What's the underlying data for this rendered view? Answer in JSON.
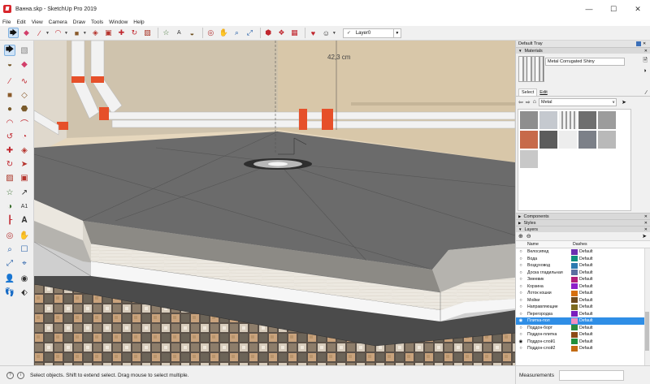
{
  "window": {
    "title": "Ванна.skp - SketchUp Pro 2019",
    "minimize": "—",
    "maximize": "☐",
    "close": "✕"
  },
  "menu": [
    "File",
    "Edit",
    "View",
    "Camera",
    "Draw",
    "Tools",
    "Window",
    "Help"
  ],
  "toolbar": {
    "layer_select_value": "Layer0",
    "layer_check": "✓"
  },
  "viewport": {
    "dimension_label": "42,3 cm"
  },
  "tray": {
    "title": "Default Tray",
    "materials_header": "Materials",
    "material_name": "Metal Corrugated Shiny",
    "tab_select": "Select",
    "tab_edit": "Edit",
    "library_value": "Metal",
    "components_header": "Components",
    "styles_header": "Styles",
    "layers_header": "Layers",
    "col_name": "Name",
    "col_dashes": "Dashes"
  },
  "layers": [
    {
      "name": "Велосипед",
      "color": "#6b2fb0",
      "dashes": "Default",
      "visible": "○",
      "selected": false
    },
    {
      "name": "Вода",
      "color": "#0f8f7e",
      "dashes": "Default",
      "visible": "○",
      "selected": false
    },
    {
      "name": "Воздуховод",
      "color": "#2c7ab0",
      "dashes": "Default",
      "visible": "○",
      "selected": false
    },
    {
      "name": "Доска гладильная",
      "color": "#5b6fa0",
      "dashes": "Default",
      "visible": "○",
      "selected": false
    },
    {
      "name": "Змеевик",
      "color": "#b21e7a",
      "dashes": "Default",
      "visible": "○",
      "selected": false
    },
    {
      "name": "Корзина",
      "color": "#8f1fc9",
      "dashes": "Default",
      "visible": "○",
      "selected": false
    },
    {
      "name": "Лоток кошки",
      "color": "#d66f0f",
      "dashes": "Default",
      "visible": "○",
      "selected": false
    },
    {
      "name": "Мойки",
      "color": "#6e4b1e",
      "dashes": "Default",
      "visible": "○",
      "selected": false
    },
    {
      "name": "Направляющие",
      "color": "#7d6a1f",
      "dashes": "Default",
      "visible": "○",
      "selected": false
    },
    {
      "name": "Перегородка",
      "color": "#7a1ebd",
      "dashes": "Default",
      "visible": "○",
      "selected": false
    },
    {
      "name": "Плитка-пол",
      "color": "#f28ec1",
      "dashes": "Default",
      "visible": "◉",
      "selected": true
    },
    {
      "name": "Поддон-борт",
      "color": "#2c8a3f",
      "dashes": "Default",
      "visible": "○",
      "selected": false
    },
    {
      "name": "Поддон-плитка",
      "color": "#8c4a16",
      "dashes": "Default",
      "visible": "○",
      "selected": false
    },
    {
      "name": "Поддон-слой1",
      "color": "#1f8f3c",
      "dashes": "Default",
      "visible": "◉",
      "selected": false
    },
    {
      "name": "Поддон-слой2",
      "color": "#c26a12",
      "dashes": "Default",
      "visible": "○",
      "selected": false
    }
  ],
  "status": {
    "icon1": "?",
    "icon2": "i",
    "text": "Select objects. Shift to extend select. Drag mouse to select multiple.",
    "measurements_label": "Measurements"
  }
}
